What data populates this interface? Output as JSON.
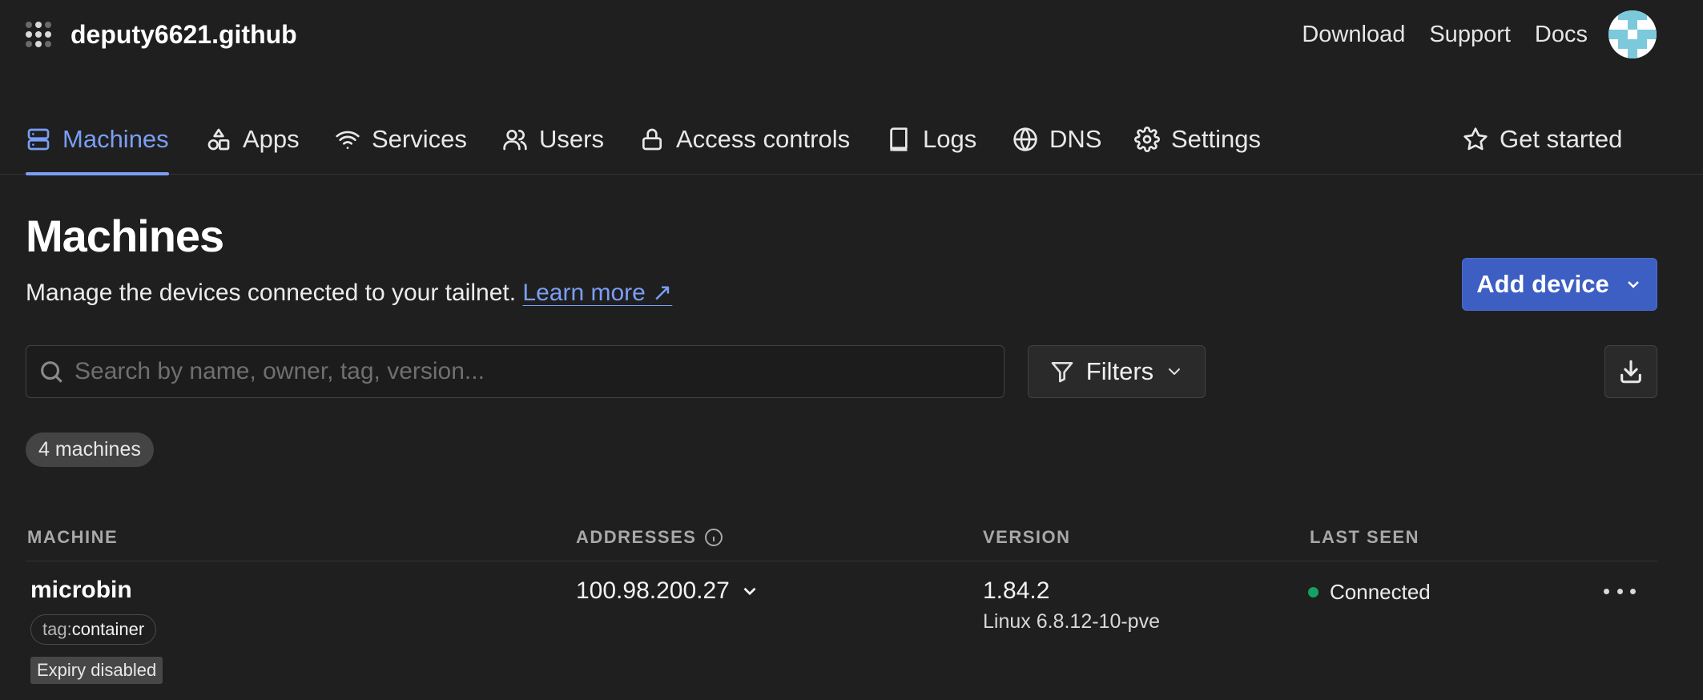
{
  "header": {
    "org_name": "deputy6621.github",
    "links": [
      "Download",
      "Support",
      "Docs"
    ]
  },
  "nav": {
    "tabs": [
      {
        "label": "Machines",
        "icon": "machines-icon",
        "active": true
      },
      {
        "label": "Apps",
        "icon": "apps-icon"
      },
      {
        "label": "Services",
        "icon": "wifi-icon"
      },
      {
        "label": "Users",
        "icon": "users-icon"
      },
      {
        "label": "Access controls",
        "icon": "lock-icon"
      },
      {
        "label": "Logs",
        "icon": "book-icon"
      },
      {
        "label": "DNS",
        "icon": "globe-icon"
      },
      {
        "label": "Settings",
        "icon": "gear-icon"
      }
    ],
    "get_started": {
      "label": "Get started",
      "icon": "star-icon"
    }
  },
  "page": {
    "title": "Machines",
    "subtitle": "Manage the devices connected to your tailnet.",
    "learn_more": "Learn more ↗",
    "add_device": "Add device"
  },
  "toolbar": {
    "search_placeholder": "Search by name, owner, tag, version...",
    "filters_label": "Filters"
  },
  "summary": {
    "count_label": "4 machines"
  },
  "table": {
    "columns": [
      "MACHINE",
      "ADDRESSES",
      "VERSION",
      "LAST SEEN"
    ],
    "rows": [
      {
        "name": "microbin",
        "tag_key": "tag:",
        "tag_value": "container",
        "expiry": "Expiry disabled",
        "address": "100.98.200.27",
        "version": "1.84.2",
        "os": "Linux 6.8.12-10-pve",
        "last_seen": "Connected",
        "status_color": "#14a163"
      }
    ]
  },
  "theme": {
    "accent": "#7b9ef5",
    "primary_button": "#3d5ec2",
    "background": "#1f1f1f"
  }
}
